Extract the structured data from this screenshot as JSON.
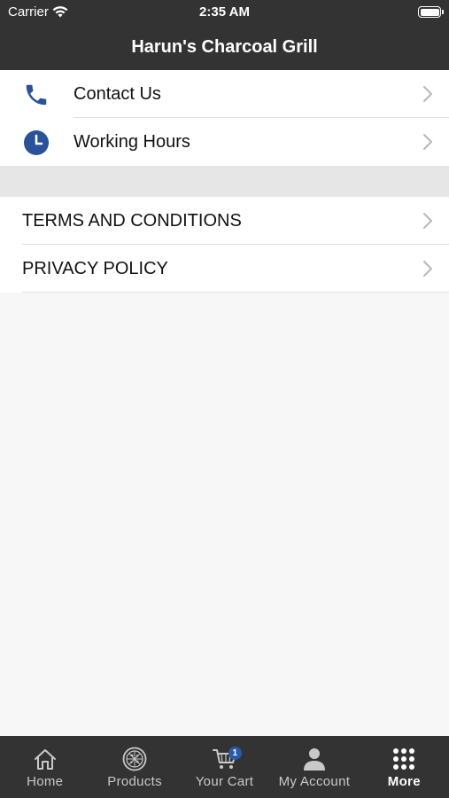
{
  "status_bar": {
    "carrier": "Carrier",
    "time": "2:35 AM",
    "wifi_icon": "wifi-icon",
    "battery_icon": "battery-icon"
  },
  "header": {
    "title": "Harun's Charcoal Grill"
  },
  "menu": {
    "contact": {
      "label": "Contact Us",
      "icon": "phone-icon"
    },
    "hours": {
      "label": "Working Hours",
      "icon": "clock-icon"
    },
    "terms": {
      "label": "TERMS AND CONDITIONS"
    },
    "privacy": {
      "label": "PRIVACY POLICY"
    }
  },
  "tabs": [
    {
      "label": "Home",
      "icon": "home-icon"
    },
    {
      "label": "Products",
      "icon": "pizza-icon"
    },
    {
      "label": "Your Cart",
      "icon": "cart-icon",
      "badge": "1"
    },
    {
      "label": "My Account",
      "icon": "user-icon"
    },
    {
      "label": "More",
      "icon": "grid-icon",
      "active": true
    }
  ],
  "colors": {
    "bar_background": "#333333",
    "icon_accent": "#2a5298",
    "badge": "#2a5aa8"
  }
}
